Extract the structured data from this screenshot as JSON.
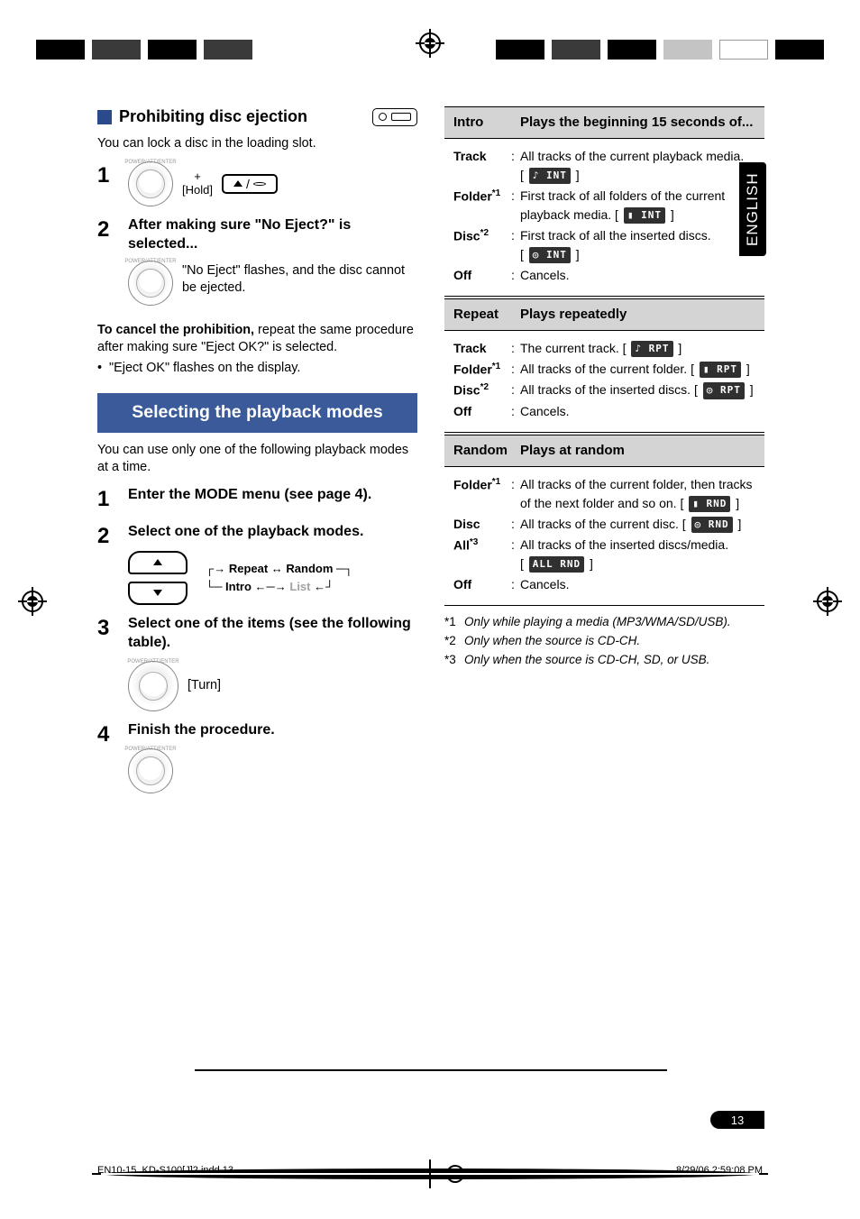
{
  "language_tab": "ENGLISH",
  "page_number": "13",
  "footer_left": "EN10-15_KD-S100[J]2.indd   13",
  "footer_right": "8/29/06   2:59:08 PM",
  "left": {
    "section1": {
      "title": "Prohibiting disc ejection",
      "intro": "You can lock a disc in the loading slot.",
      "step1_hold": "[Hold]",
      "step2_title": "After making sure \"No Eject?\" is selected...",
      "step2_desc": "\"No Eject\" flashes, and the disc cannot be ejected.",
      "cancel_bold": "To cancel the prohibition,",
      "cancel_rest": " repeat the same procedure after making sure \"Eject OK?\" is selected.",
      "cancel_bullet": "\"Eject OK\" flashes on the display."
    },
    "section2": {
      "band": "Selecting the playback modes",
      "intro": "You can use only one of the following playback modes at a time.",
      "step1": "Enter the MODE menu (see page 4).",
      "step2": "Select one of the playback modes.",
      "modes": {
        "a": "Repeat",
        "b": "Random",
        "c": "Intro",
        "d": "List"
      },
      "step3": "Select one of the items (see the following table).",
      "step3_turn": "[Turn]",
      "step4": "Finish the procedure."
    }
  },
  "right": {
    "intro": {
      "header_a": "Intro",
      "header_b": "Plays the beginning 15 seconds of...",
      "rows": [
        {
          "label": "Track",
          "sup": "",
          "desc": "All tracks of the current playback media.",
          "seg": "♪ INT"
        },
        {
          "label": "Folder",
          "sup": "*1",
          "desc": "First track of all folders of the current playback media. ",
          "seg": "▮ INT"
        },
        {
          "label": "Disc",
          "sup": "*2",
          "desc": "First track of all the inserted discs.",
          "seg": "◎ INT"
        },
        {
          "label": "Off",
          "sup": "",
          "desc": "Cancels.",
          "seg": ""
        }
      ]
    },
    "repeat": {
      "header_a": "Repeat",
      "header_b": "Plays repeatedly",
      "rows": [
        {
          "label": "Track",
          "sup": "",
          "desc": "The current track. ",
          "seg": "♪ RPT"
        },
        {
          "label": "Folder",
          "sup": "*1",
          "desc": "All tracks of the current folder. ",
          "seg": "▮ RPT"
        },
        {
          "label": "Disc",
          "sup": "*2",
          "desc": "All tracks of the inserted discs. ",
          "seg": "◎ RPT"
        },
        {
          "label": "Off",
          "sup": "",
          "desc": "Cancels.",
          "seg": ""
        }
      ]
    },
    "random": {
      "header_a": "Random",
      "header_b": "Plays at random",
      "rows": [
        {
          "label": "Folder",
          "sup": "*1",
          "desc": "All tracks of the current folder, then tracks of the next folder and so on. ",
          "seg": "▮ RND"
        },
        {
          "label": "Disc",
          "sup": "",
          "desc": "All tracks of the current disc. ",
          "seg": "◎ RND"
        },
        {
          "label": "All",
          "sup": "*3",
          "desc": "All tracks of the inserted discs/media.",
          "seg": "ALL RND"
        },
        {
          "label": "Off",
          "sup": "",
          "desc": "Cancels.",
          "seg": ""
        }
      ]
    },
    "footnotes": [
      {
        "mark": "*1",
        "text": "Only while playing a media (MP3/WMA/SD/USB)."
      },
      {
        "mark": "*2",
        "text": "Only when the source is CD-CH."
      },
      {
        "mark": "*3",
        "text": "Only when the source is CD-CH, SD, or USB."
      }
    ]
  }
}
